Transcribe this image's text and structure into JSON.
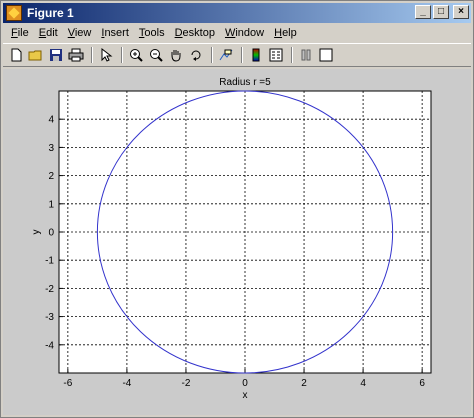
{
  "window": {
    "title": "Figure 1"
  },
  "title_buttons": {
    "minimize": "_",
    "maximize": "□",
    "close": "×"
  },
  "menu": [
    {
      "prefix": "",
      "key": "F",
      "rest": "ile"
    },
    {
      "prefix": "",
      "key": "E",
      "rest": "dit"
    },
    {
      "prefix": "",
      "key": "V",
      "rest": "iew"
    },
    {
      "prefix": "",
      "key": "I",
      "rest": "nsert"
    },
    {
      "prefix": "",
      "key": "T",
      "rest": "ools"
    },
    {
      "prefix": "",
      "key": "D",
      "rest": "esktop"
    },
    {
      "prefix": "",
      "key": "W",
      "rest": "indow"
    },
    {
      "prefix": "",
      "key": "H",
      "rest": "elp"
    }
  ],
  "toolbar": {
    "icons": [
      "new-file-icon",
      "open-file-icon",
      "save-icon",
      "print-icon",
      "arrow-pointer-icon",
      "zoom-in-icon",
      "zoom-out-icon",
      "pan-hand-icon",
      "rotate-3d-icon",
      "data-cursor-icon",
      "colorbar-icon",
      "legend-icon",
      "hide-plot-tools-icon",
      "show-plot-tools-icon"
    ]
  },
  "chart_data": {
    "type": "line",
    "title": "Radius r =5",
    "xlabel": "x",
    "ylabel": "y",
    "xlim": [
      -6.3,
      6.3
    ],
    "ylim": [
      -5,
      5
    ],
    "xticks": [
      -6,
      -4,
      -2,
      0,
      2,
      4,
      6
    ],
    "yticks": [
      -4,
      -3,
      -2,
      -1,
      0,
      1,
      2,
      3,
      4
    ],
    "grid": true,
    "series": [
      {
        "shape": "circle",
        "center": [
          0,
          0
        ],
        "radius": 5,
        "color": "#3333cc"
      }
    ]
  }
}
